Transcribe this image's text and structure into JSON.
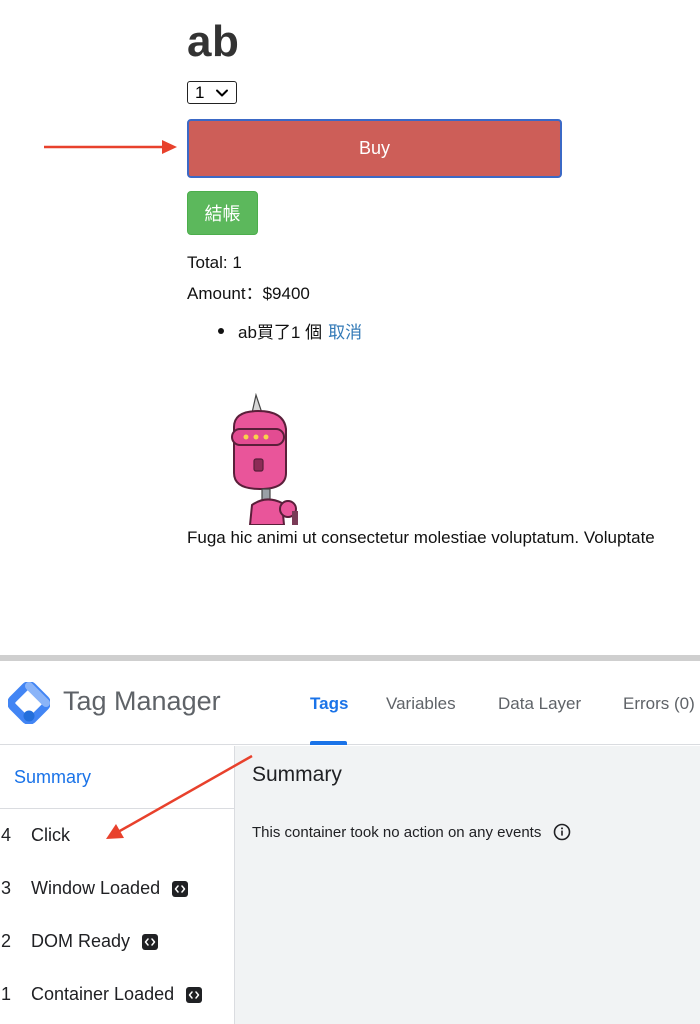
{
  "shop": {
    "product_title": "ab",
    "quantity": {
      "selected": "1"
    },
    "buy_label": "Buy",
    "checkout_label": "結帳",
    "total_text": "Total: 1",
    "amount_text": "Amount：$9400",
    "cart_items": [
      {
        "text": "ab買了1 個",
        "cancel_label": "取消"
      }
    ],
    "lorem_text": "Fuga hic animi ut consectetur molestiae voluptatum. Voluptate",
    "colors": {
      "buy": "#cd5e58",
      "buy_border": "#3b69c6",
      "checkout": "#5cb85c",
      "link": "#337ab7",
      "annotation_arrow": "#e8412c"
    }
  },
  "gtm": {
    "app_title": "Tag Manager",
    "tabs": [
      {
        "label": "Tags",
        "active": true
      },
      {
        "label": "Variables"
      },
      {
        "label": "Data Layer"
      },
      {
        "label": "Errors (0)"
      }
    ],
    "sidebar": {
      "summary_label": "Summary",
      "events": [
        {
          "num": "4",
          "label": "Click",
          "icon": null
        },
        {
          "num": "3",
          "label": "Window Loaded",
          "icon": "code-icon"
        },
        {
          "num": "2",
          "label": "DOM Ready",
          "icon": "code-icon"
        },
        {
          "num": "1",
          "label": "Container Loaded",
          "icon": "code-icon"
        }
      ]
    },
    "main": {
      "title": "Summary",
      "message": "This container took no action on any events",
      "message_icon": "info-icon"
    },
    "colors": {
      "accent": "#1a73e8",
      "panel_bg": "#f1f3f4"
    }
  }
}
